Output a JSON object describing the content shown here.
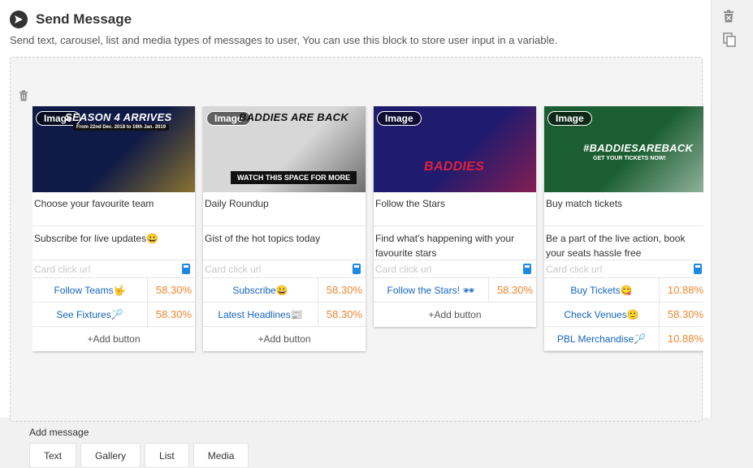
{
  "header": {
    "title": "Send Message",
    "description": "Send text, carousel, list and media types of messages to user, You can use this block to store user input in a variable."
  },
  "cards": [
    {
      "image": {
        "badge": "Image",
        "headline": "SEASON 4 ARRIVES",
        "subline": "From 22nd Dec. 2018 to 19th Jan. 2019",
        "bg": "#101a46",
        "accent": "#f6c21f"
      },
      "title": "Choose your favourite team",
      "subtitle": "Subscribe for live updates😀",
      "url_placeholder": "Card click url",
      "buttons": [
        {
          "label": "Follow Teams🤟",
          "pct": "58.30%"
        },
        {
          "label": "See Fixtures🏸",
          "pct": "58.30%"
        }
      ],
      "add_label": "+Add button"
    },
    {
      "image": {
        "badge": "Image",
        "headline": "BADDIES ARE BACK",
        "subline": "WATCH THIS SPACE FOR MORE",
        "bg": "#d7d7d7",
        "accent": "#111111"
      },
      "title": "Daily Roundup",
      "subtitle": "Gist of the hot topics today",
      "url_placeholder": "Card click url",
      "buttons": [
        {
          "label": "Subscribe😀",
          "pct": "58.30%"
        },
        {
          "label": "Latest Headlines📰",
          "pct": "58.30%"
        }
      ],
      "add_label": "+Add button"
    },
    {
      "image": {
        "badge": "Image",
        "headline": "BADDIES",
        "subline": "",
        "bg": "#1f1b6e",
        "accent": "#e0213b"
      },
      "title": "Follow the Stars",
      "subtitle": "Find what's happening with your favourite stars",
      "url_placeholder": "Card click url",
      "buttons": [
        {
          "label": "Follow the Stars! 🕶",
          "pct": "58.30%"
        }
      ],
      "add_label": "+Add button"
    },
    {
      "image": {
        "badge": "Image",
        "headline": "#BADDIESAREBACK",
        "subline": "GET YOUR TICKETS NOW!",
        "bg": "#1b5e32",
        "accent": "#ffffff"
      },
      "title": "Buy match tickets",
      "subtitle": "Be a part of the live action, book your seats hassle free",
      "url_placeholder": "Card click url",
      "buttons": [
        {
          "label": "Buy Tickets😋",
          "pct": "10.88%"
        },
        {
          "label": "Check Venues🙂",
          "pct": "58.30%"
        },
        {
          "label": "PBL Merchandise🏸",
          "pct": "10.88%"
        }
      ],
      "add_label": ""
    }
  ],
  "add_message": {
    "label": "Add message",
    "types": [
      "Text",
      "Gallery",
      "List",
      "Media"
    ]
  },
  "colors": {
    "link": "#1565c0",
    "percent": "#f0852d",
    "url_icon": "#1e88e5"
  },
  "icons": {
    "header": "send-icon",
    "block_delete": "trash-icon",
    "side_delete": "trash-icon",
    "side_copy": "copy-icon",
    "url": "mobile-icon"
  }
}
